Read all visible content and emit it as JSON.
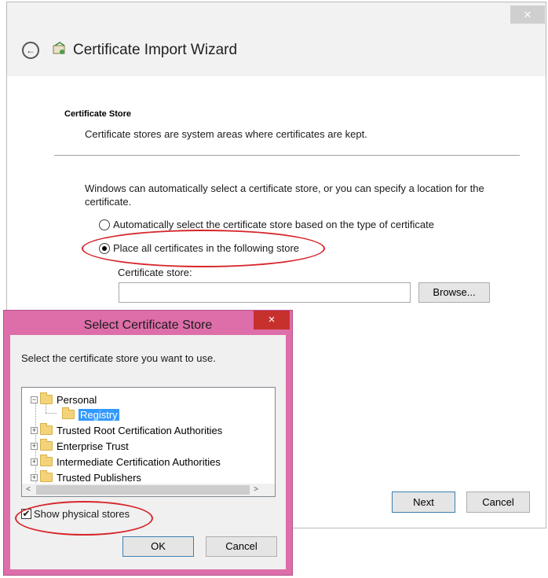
{
  "wizard": {
    "title": "Certificate Import Wizard",
    "close_glyph": "×",
    "back_glyph": "←",
    "section_title": "Certificate Store",
    "section_desc": "Certificate stores are system areas where certificates are kept.",
    "intro": "Windows can automatically select a certificate store, or you can specify a location for the certificate.",
    "radio_auto": "Automatically select the certificate store based on the type of certificate",
    "radio_place": "Place all certificates in the following store",
    "store_label": "Certificate store:",
    "store_value": "",
    "browse_label": "Browse...",
    "next_label": "Next",
    "cancel_label": "Cancel"
  },
  "dialog": {
    "title": "Select Certificate Store",
    "close_glyph": "×",
    "prompt": "Select the certificate store you want to use.",
    "tree": [
      {
        "label": "Personal",
        "expander": "−"
      },
      {
        "label": "Registry",
        "expander": ""
      },
      {
        "label": "Trusted Root Certification Authorities",
        "expander": "+"
      },
      {
        "label": "Enterprise Trust",
        "expander": "+"
      },
      {
        "label": "Intermediate Certification Authorities",
        "expander": "+"
      },
      {
        "label": "Trusted Publishers",
        "expander": "+"
      }
    ],
    "show_physical_label": "Show physical stores",
    "show_physical_checked": "✔",
    "ok_label": "OK",
    "cancel_label": "Cancel",
    "scroll_up": "▲",
    "scroll_down": "▼",
    "scroll_left": "<",
    "scroll_right": ">"
  },
  "colors": {
    "dialog_frame": "#dd6ea9",
    "annotation": "#d7262b",
    "selection": "#3399ff"
  }
}
